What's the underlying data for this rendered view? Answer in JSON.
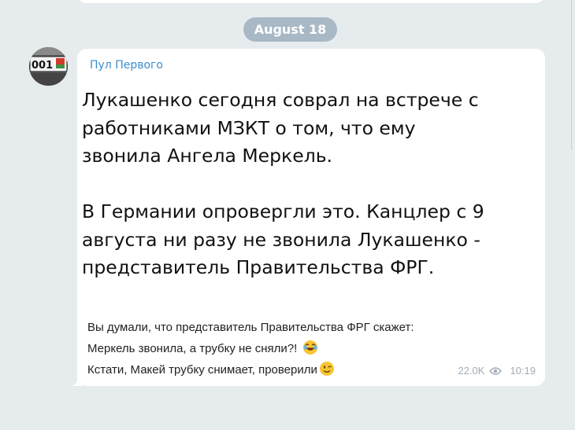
{
  "date_separator": "August 18",
  "post": {
    "channel_name": "Пул Первого",
    "main_lines": [
      "Лукашенко сегодня соврал на встрече с",
      "работниками МЗКТ о том, что ему",
      "звонила Ангела Меркель.",
      "В Германии опровергли это. Канцлер с 9",
      "августа ни разу не звонила Лукашенко -",
      "представитель Правительства ФРГ."
    ],
    "small_lines": [
      "Вы думали, что представитель Правительства ФРГ скажет:",
      "Меркель звонила, а трубку не сняли?!",
      "Кстати, Макей трубку снимает, проверили"
    ],
    "views": "22.0K",
    "time": "10:19"
  },
  "colors": {
    "background": "#e6ebee",
    "bubble": "#ffffff",
    "channel_name": "#3a8ed0",
    "date_pill": "#a8b8c5",
    "meta": "#a0acb6"
  },
  "icons": [
    "avatar-license-plate",
    "laughing-emoji",
    "winking-emoji",
    "eye-icon"
  ]
}
